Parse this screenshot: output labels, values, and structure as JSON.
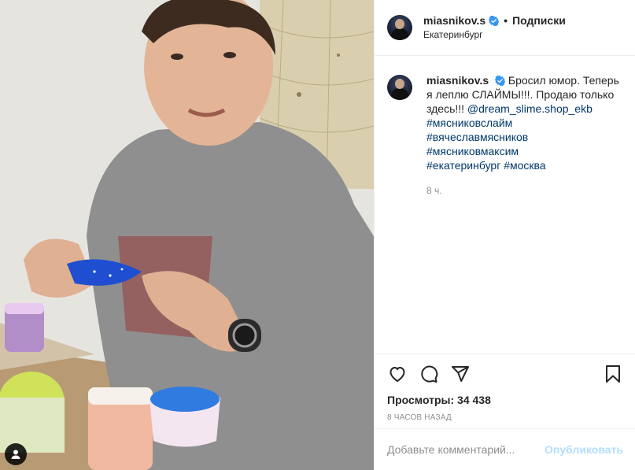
{
  "post": {
    "username": "miasnikov.s",
    "separator": "•",
    "follow_label": "Подписки",
    "location": "Екатеринбург",
    "caption_text": "Бросил юмор. Теперь я леплю СЛАЙМЫ!!!. Продаю только здесь!!!",
    "caption_mention": "@dream_slime.shop_ekb",
    "hashtags": [
      "#мясниковслайм",
      "#вячеславмясников",
      "#мясниковмаксим",
      "#екатеринбург",
      "#москва"
    ],
    "comment_time": "8 ч.",
    "views_label": "Просмотры: 34 438",
    "time_ago": "8 часов назад",
    "comment_placeholder": "Добавьте комментарий...",
    "publish_label": "Опубликовать",
    "icons": {
      "like": "heart-icon",
      "comment": "comment-icon",
      "share": "share-icon",
      "save": "bookmark-icon",
      "verified": "verified-badge-icon",
      "tagged": "user-tag-icon"
    },
    "colors": {
      "link": "#00376b",
      "secondary_text": "#8e8e8e",
      "verified": "#3897f0",
      "publish_disabled": "#b2dffc"
    }
  }
}
